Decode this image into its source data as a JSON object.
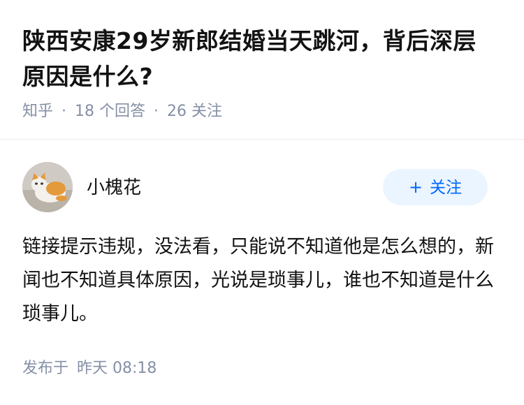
{
  "question": {
    "title": "陕西安康29岁新郎结婚当天跳河，背后深层原因是什么?",
    "source": "知乎",
    "answer_count": "18 个回答",
    "follower_count": "26 关注",
    "separator": "·"
  },
  "answer": {
    "author": {
      "name": "小槐花",
      "avatar_icon": "cat-avatar"
    },
    "follow_button": {
      "icon": "+",
      "label": "关注"
    },
    "content": "链接提示违规，没法看，只能说不知道他是怎么想的，新闻也不知道具体原因，光说是琐事儿，谁也不知道是什么琐事儿。",
    "publish_label": "发布于",
    "publish_time": "昨天 08:18"
  },
  "colors": {
    "text_primary": "#121212",
    "text_secondary": "#8590a6",
    "accent": "#0066ff",
    "follow_bg": "#ebf5ff",
    "divider": "#ebebeb"
  }
}
